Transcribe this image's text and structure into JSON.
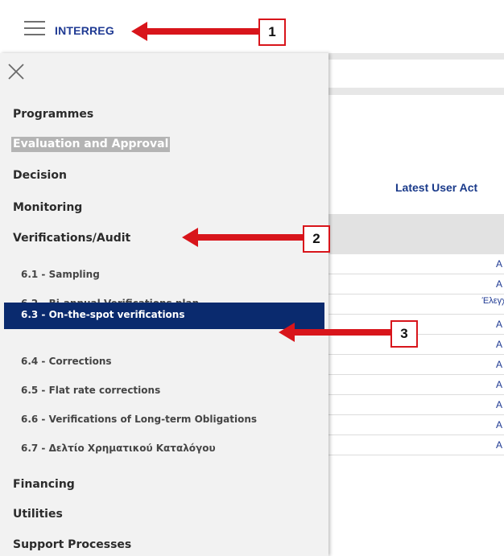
{
  "header": {
    "brand": "INTERREG"
  },
  "background": {
    "panel_title": "Latest User Act",
    "rows": [
      "A",
      "A",
      "Έλεγχος",
      "A",
      "A",
      "A",
      "A",
      "A",
      "A",
      "A"
    ]
  },
  "drawer": {
    "menu": [
      {
        "label": "Programmes"
      },
      {
        "label": "Evaluation and Approval"
      },
      {
        "label": "Decision"
      },
      {
        "label": "Monitoring"
      },
      {
        "label": "Verifications/Audit"
      }
    ],
    "submenu": [
      {
        "label": "6.1 - Sampling"
      },
      {
        "label": "6.2 - Bi-annual Verifications plan"
      },
      {
        "label": "6.3 - On-the-spot verifications"
      },
      {
        "label": "6.4 - Corrections"
      },
      {
        "label": "6.5 - Flat rate corrections"
      },
      {
        "label": "6.6 - Verifications of Long-term Obligations"
      },
      {
        "label": "6.7 - Δελτίο Χρηματικού Καταλόγου"
      }
    ],
    "menu_after": [
      {
        "label": "Financing"
      },
      {
        "label": "Utilities"
      },
      {
        "label": "Support Processes"
      }
    ]
  },
  "callouts": [
    "1",
    "2",
    "3"
  ],
  "colors": {
    "brand": "#1f3a93",
    "active_bg": "#0a2a6e",
    "highlight_bg": "#b4b4b4",
    "callout": "#d8151b"
  }
}
